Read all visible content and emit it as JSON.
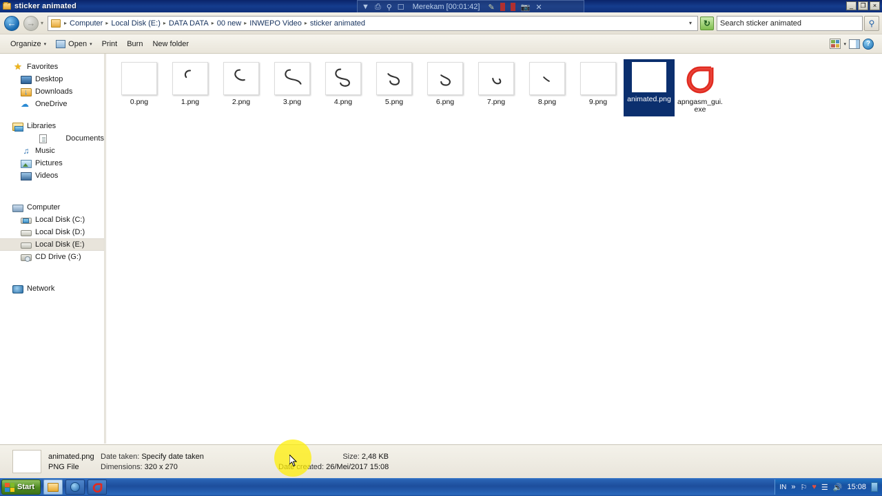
{
  "window": {
    "title": "sticker animated",
    "minimize_label": "_",
    "maximize_label": "❐",
    "close_label": "×"
  },
  "recorder_overlay": {
    "status_text": "Merekam [00:01:42]",
    "icons": [
      "chevron-down-icon",
      "window-icon",
      "magnifier-icon",
      "region-icon",
      "pencil-icon",
      "pause-icon",
      "stop-icon",
      "camera-icon",
      "close-icon"
    ]
  },
  "addressbar": {
    "back_label": "←",
    "forward_label": "→",
    "recent_label": "▾",
    "breadcrumbs": [
      "Computer",
      "Local Disk (E:)",
      "DATA DATA",
      "00 new",
      "INWEPO Video",
      "sticker animated"
    ],
    "separator": "▸",
    "dropdown_label": "▾",
    "refresh_label": "↻",
    "search_value": "Search sticker animated",
    "search_placeholder": "Search sticker animated"
  },
  "commandbar": {
    "organize": "Organize",
    "open": "Open",
    "print": "Print",
    "burn": "Burn",
    "new_folder": "New folder",
    "caret": "▾",
    "help_label": "?"
  },
  "sidebar": {
    "groups": [
      {
        "header": {
          "label": "Favorites",
          "icon": "star-icon"
        },
        "items": [
          {
            "label": "Desktop",
            "icon": "desktop-icon"
          },
          {
            "label": "Downloads",
            "icon": "downloads-folder-icon"
          },
          {
            "label": "OneDrive",
            "icon": "cloud-icon"
          }
        ]
      },
      {
        "header": {
          "label": "Libraries",
          "icon": "libraries-icon"
        },
        "items": [
          {
            "label": "Documents",
            "icon": "document-icon"
          },
          {
            "label": "Music",
            "icon": "music-note-icon"
          },
          {
            "label": "Pictures",
            "icon": "picture-icon"
          },
          {
            "label": "Videos",
            "icon": "video-icon"
          }
        ]
      },
      {
        "header": {
          "label": "Computer",
          "icon": "computer-icon"
        },
        "items": [
          {
            "label": "Local Disk (C:)",
            "icon": "system-drive-icon"
          },
          {
            "label": "Local Disk (D:)",
            "icon": "drive-icon"
          },
          {
            "label": "Local Disk (E:)",
            "icon": "drive-icon",
            "selected": true
          },
          {
            "label": "CD Drive (G:)",
            "icon": "cd-drive-icon"
          }
        ]
      },
      {
        "header": {
          "label": "Network",
          "icon": "network-icon"
        },
        "items": []
      }
    ]
  },
  "files": [
    {
      "name": "0.png",
      "thumb": "stroke-0",
      "selected": false
    },
    {
      "name": "1.png",
      "thumb": "stroke-1",
      "selected": false
    },
    {
      "name": "2.png",
      "thumb": "stroke-2",
      "selected": false
    },
    {
      "name": "3.png",
      "thumb": "stroke-3",
      "selected": false
    },
    {
      "name": "4.png",
      "thumb": "stroke-4",
      "selected": false
    },
    {
      "name": "5.png",
      "thumb": "stroke-5",
      "selected": false
    },
    {
      "name": "6.png",
      "thumb": "stroke-6",
      "selected": false
    },
    {
      "name": "7.png",
      "thumb": "stroke-7",
      "selected": false
    },
    {
      "name": "8.png",
      "thumb": "stroke-8",
      "selected": false
    },
    {
      "name": "9.png",
      "thumb": "stroke-9",
      "selected": false
    },
    {
      "name": "animated.png",
      "thumb": "blank-image",
      "selected": true
    },
    {
      "name": "apngasm_gui.exe",
      "thumb": "apngasm-logo-icon",
      "selected": false
    }
  ],
  "details": {
    "file_name": "animated.png",
    "file_type": "PNG File",
    "date_taken_label": "Date taken:",
    "date_taken_value": "Specify date taken",
    "dimensions_label": "Dimensions:",
    "dimensions_value": "320 x 270",
    "size_label": "Size:",
    "size_value": "2,48 KB",
    "date_created_label": "Date created:",
    "date_created_value": "26/Mei/2017 15:08"
  },
  "taskbar": {
    "start_label": "Start",
    "buttons": [
      {
        "name": "explorer",
        "icon": "folder-icon",
        "active": true
      },
      {
        "name": "browser",
        "icon": "globe-icon",
        "active": false
      },
      {
        "name": "apngasm",
        "icon": "apngasm-logo-icon",
        "active": false
      }
    ],
    "tray": {
      "language": "IN",
      "show_hidden": "»",
      "icons": [
        "flag-icon",
        "antivirus-icon",
        "network-icon",
        "volume-icon"
      ],
      "clock": "15:08",
      "show_desktop": "show-desktop-icon"
    }
  },
  "colors": {
    "titlebar": "#123a8c",
    "selection": "#0b2f6e",
    "click_highlight": "#ffef00",
    "taskbar": "#1d4e9c"
  }
}
